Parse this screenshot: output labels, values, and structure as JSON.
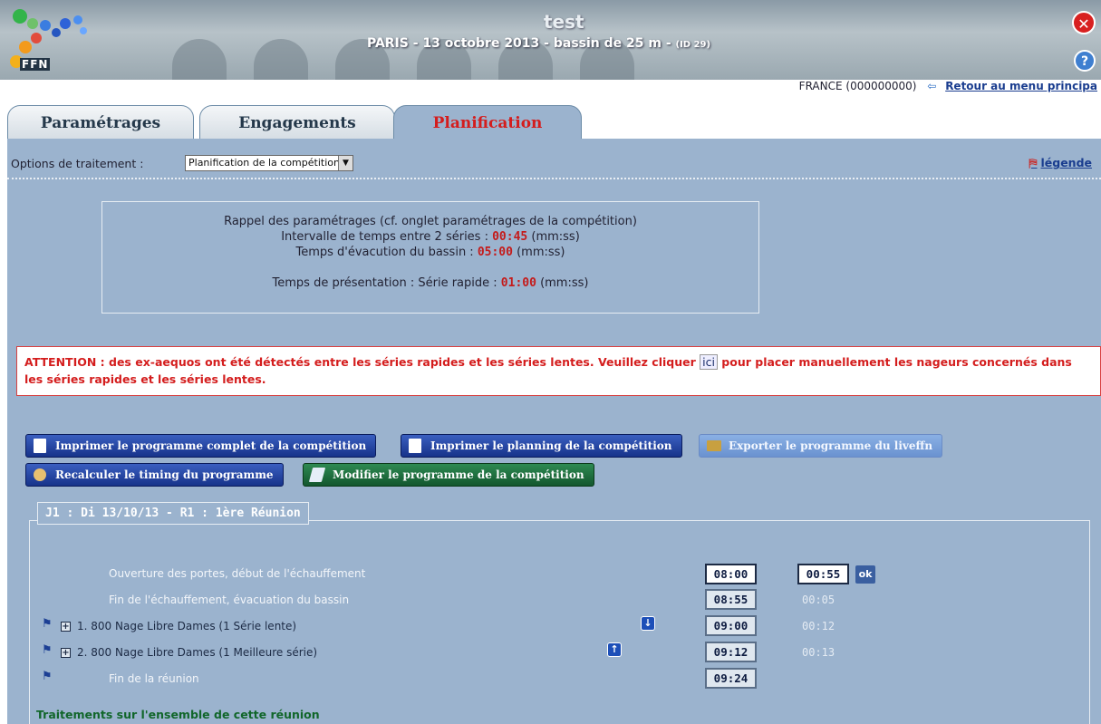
{
  "header": {
    "app_title": "test",
    "subtitle": "PARIS - 13 octobre 2013 - bassin de 25 m - ",
    "id_label": "(ID 29)",
    "logo_text": "FFN"
  },
  "userbar": {
    "account": "FRANCE (000000000)",
    "back_label": "Retour au menu principa"
  },
  "tabs": [
    {
      "label": "Paramétrages",
      "active": false
    },
    {
      "label": "Engagements",
      "active": false
    },
    {
      "label": "Planification",
      "active": true
    }
  ],
  "options": {
    "label": "Options de traitement :",
    "selected": "Planification de la compétition",
    "legend_label": "légende"
  },
  "reminder": {
    "line1": "Rappel des paramétrages (cf. onglet paramétrages de la compétition)",
    "interval_label": "Intervalle de temps entre 2 séries : ",
    "interval_value": "00:45",
    "evac_label": "Temps d'évacution du bassin : ",
    "evac_value": "05:00",
    "presentation_label": "Temps de présentation : Série rapide : ",
    "presentation_value": "01:00",
    "unit": " (mm:ss)"
  },
  "alert": {
    "text_before": "ATTENTION : des ex-aequos ont été détectés entre les séries rapides et les séries lentes. Veuillez cliquer ",
    "link": "ici",
    "text_after": " pour placer manuellement les nageurs concernés dans les séries rapides et les séries lentes."
  },
  "buttons": {
    "print_full": "Imprimer le programme complet de la compétition",
    "print_planning": "Imprimer le planning de la compétition",
    "export_liveffn": "Exporter le programme du liveffn",
    "recalc": "Recalculer le timing du programme",
    "modify": "Modifier le programme de la compétition"
  },
  "session": {
    "title": "J1 : Di 13/10/13 - R1 : 1ère Réunion",
    "rows": [
      {
        "label": "Ouverture des portes, début de l'échauffement",
        "time": "08:00",
        "duration": "00:55",
        "ok": "ok"
      },
      {
        "label": "Fin de l'échauffement, évacuation du bassin",
        "time": "08:55",
        "duration": "00:05"
      },
      {
        "num": "1.",
        "label": "800 Nage Libre Dames (1 Série lente)",
        "time": "09:00",
        "duration": "00:12"
      },
      {
        "num": "2.",
        "label": "800 Nage Libre Dames (1 Meilleure série)",
        "time": "09:12",
        "duration": "00:13"
      },
      {
        "label": "Fin de la réunion",
        "time": "09:24"
      }
    ],
    "treatments_title": "Traitements sur l'ensemble de cette réunion"
  },
  "colors": {
    "panel": "#9bb3ce",
    "accent_red": "#d41d1d",
    "button_blue": "#17338a",
    "button_green": "#13572e"
  }
}
